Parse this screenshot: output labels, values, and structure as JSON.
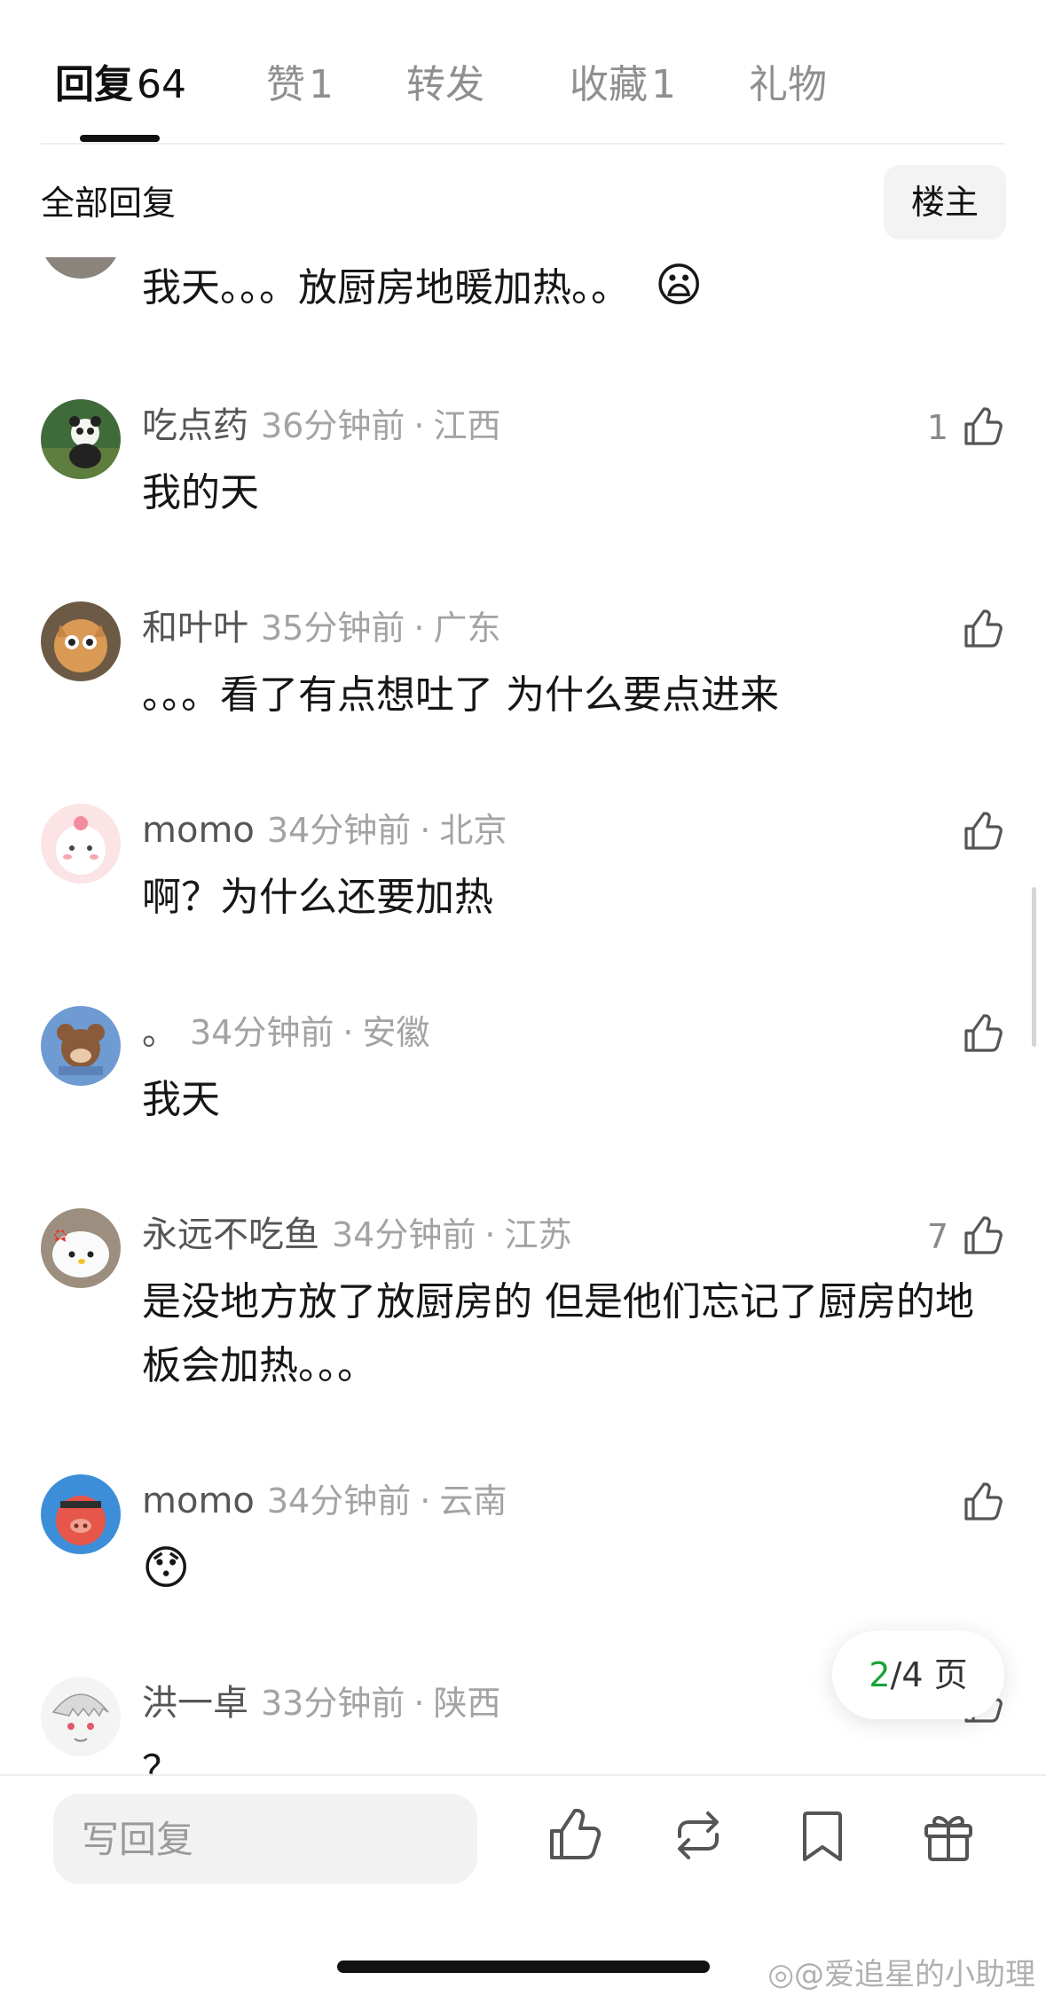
{
  "tabs": [
    {
      "label": "回复",
      "count": "64"
    },
    {
      "label": "赞",
      "count": "1"
    },
    {
      "label": "转发",
      "count": ""
    },
    {
      "label": "收藏",
      "count": "1"
    },
    {
      "label": "礼物",
      "count": ""
    }
  ],
  "filter": {
    "label": "全部回复",
    "op_button": "楼主"
  },
  "comments": [
    {
      "user": "",
      "time": "",
      "location": "",
      "text": "我天。。。放厨房地暖加热。。",
      "emoji": "😦",
      "likes": ""
    },
    {
      "user": "吃点药",
      "time": "36分钟前",
      "location": "江西",
      "text": "我的天",
      "emoji": "",
      "likes": "1"
    },
    {
      "user": "和叶叶",
      "time": "35分钟前",
      "location": "广东",
      "text": "。。。看了有点想吐了 为什么要点进来",
      "emoji": "",
      "likes": ""
    },
    {
      "user": "momo",
      "time": "34分钟前",
      "location": "北京",
      "text": "啊？为什么还要加热",
      "emoji": "",
      "likes": ""
    },
    {
      "user": "。",
      "time": "34分钟前",
      "location": "安徽",
      "text": "我天",
      "emoji": "",
      "likes": ""
    },
    {
      "user": "永远不吃鱼",
      "time": "34分钟前",
      "location": "江苏",
      "text": "是没地方放了放厨房的  但是他们忘记了厨房的地板会加热。。。",
      "emoji": "",
      "likes": "7"
    },
    {
      "user": "momo",
      "time": "34分钟前",
      "location": "云南",
      "text": "",
      "emoji": "😯",
      "likes": ""
    },
    {
      "user": "洪一卓",
      "time": "33分钟前",
      "location": "陕西",
      "text": "？",
      "emoji": "",
      "likes": ""
    }
  ],
  "pagination": {
    "current": "2",
    "rest": "/4 页"
  },
  "bottom_bar": {
    "reply_placeholder": "写回复"
  },
  "watermark": "@爱追星的小助理",
  "icons": {
    "like": "thumbs-up-icon",
    "repost": "repost-icon",
    "bookmark": "bookmark-icon",
    "gift": "gift-icon",
    "weibo": "weibo-logo-icon"
  },
  "colors": {
    "accent_green": "#1aa33a",
    "meta_grey": "#a3a3a3",
    "text": "#161616"
  }
}
